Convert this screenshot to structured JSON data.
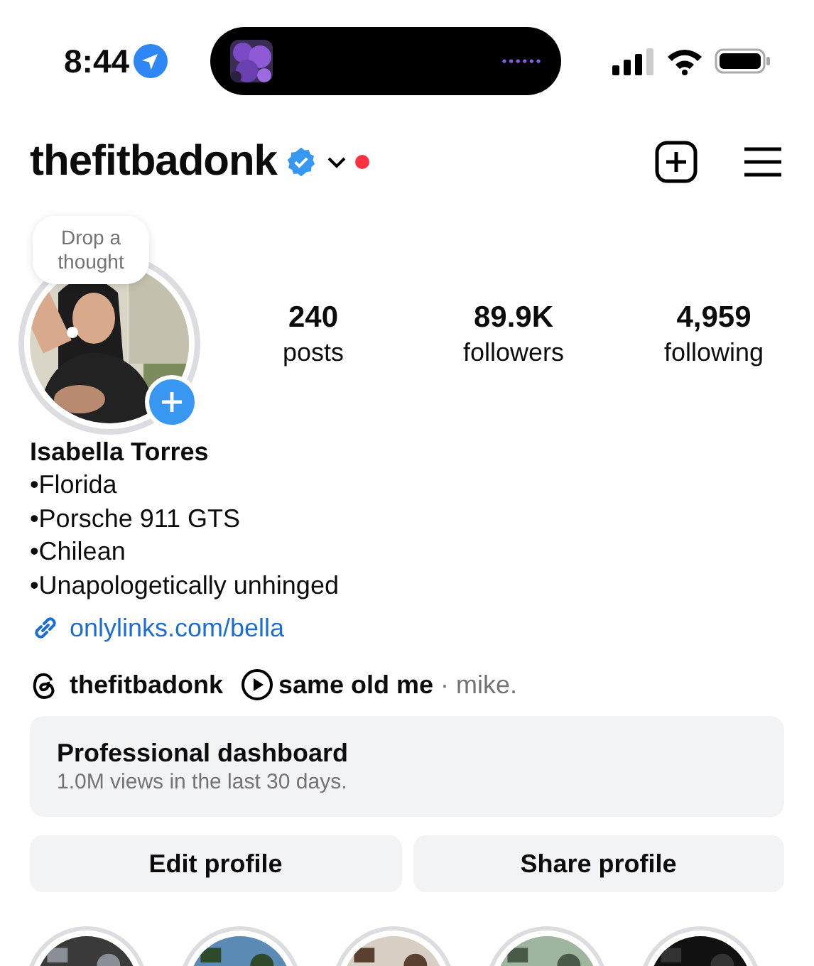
{
  "status_bar": {
    "time": "8:44",
    "location_active": true
  },
  "header": {
    "username": "thefitbadonk",
    "verified": true,
    "has_notification": true
  },
  "profile": {
    "note_bubble": "Drop a thought",
    "stats": [
      {
        "value": "240",
        "label": "posts"
      },
      {
        "value": "89.9K",
        "label": "followers"
      },
      {
        "value": "4,959",
        "label": "following"
      }
    ],
    "name": "Isabella Torres",
    "bio": [
      "•Florida",
      "•Porsche 911 GTS",
      "•Chilean",
      "•Unapologetically unhinged"
    ],
    "link": "onlylinks.com/bella",
    "threads_handle": "thefitbadonk",
    "music": {
      "title": "same old me",
      "artist": "· mike."
    }
  },
  "dashboard": {
    "title": "Professional dashboard",
    "subtitle": "1.0M views in the last 30 days."
  },
  "buttons": [
    "Edit profile",
    "Share profile"
  ],
  "highlights": [
    {
      "kind": "picture"
    },
    {
      "kind": "picture"
    },
    {
      "kind": "picture"
    },
    {
      "kind": "picture"
    },
    {
      "kind": "picture"
    }
  ]
}
